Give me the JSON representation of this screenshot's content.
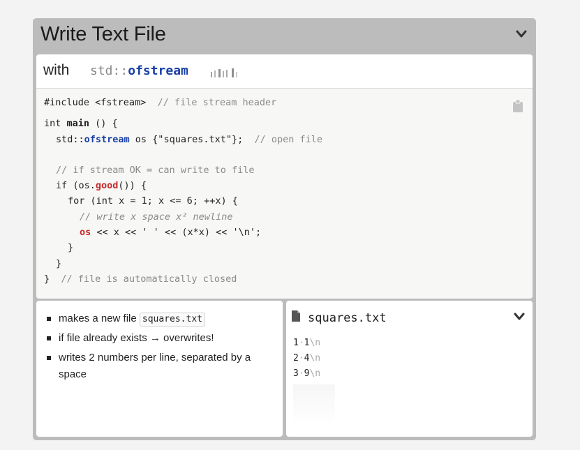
{
  "panel": {
    "title": "Write Text File"
  },
  "subheader": {
    "with_word": "with",
    "namespace": "std::",
    "type": "ofstream"
  },
  "code": {
    "l1": {
      "text": "#include <fstream>",
      "comment": "// file stream header"
    },
    "l2": {
      "kw": "int",
      "name": "main",
      "rest": " () {"
    },
    "l3": {
      "ns": "std::",
      "type": "ofstream",
      "rest": " os {\"squares.txt\"};",
      "comment": "// open file"
    },
    "l4": {
      "comment": "// if stream OK = can write to file"
    },
    "l5": {
      "pre": "if (os.",
      "fn": "good",
      "post": "()) {"
    },
    "l6": {
      "text": "for (int x = 1; x <= 6; ++x) {"
    },
    "l7": {
      "comment": "// write x space x² newline"
    },
    "l8": {
      "os": "os",
      "p1": " << x << ",
      "q1": "' '",
      "p2": " << (x*x) << ",
      "q2": "'\\n'",
      "end": ";"
    },
    "l9": {
      "text": "}"
    },
    "l10": {
      "text": "}"
    },
    "l11": {
      "text": "}",
      "comment": "// file is automatically closed"
    }
  },
  "notes": {
    "b1_pre": "makes a new file",
    "b1_code": "squares.txt",
    "b2": "if file already exists → overwrites!",
    "b3": "writes 2 numbers per line, separated by a space"
  },
  "file": {
    "name": "squares.txt",
    "lines": [
      {
        "a": "1",
        "b": "1",
        "nl": "\\n"
      },
      {
        "a": "2",
        "b": "4",
        "nl": "\\n"
      },
      {
        "a": "3",
        "b": "9",
        "nl": "\\n"
      }
    ],
    "space_marker": "·"
  },
  "icons": {
    "collapse": "chevron-down-icon",
    "copy": "clipboard-icon",
    "file": "file-icon"
  }
}
